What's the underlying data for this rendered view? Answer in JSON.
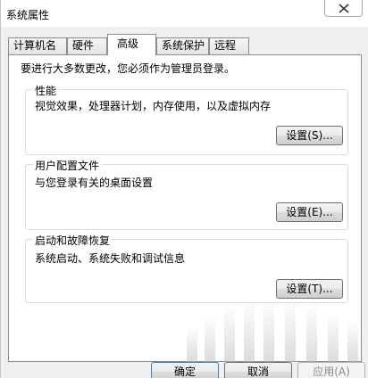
{
  "window": {
    "title": "系统属性"
  },
  "tabs": [
    {
      "label": "计算机名"
    },
    {
      "label": "硬件"
    },
    {
      "label": "高级",
      "active": true
    },
    {
      "label": "系统保护"
    },
    {
      "label": "远程"
    }
  ],
  "notice": "要进行大多数更改，您必须作为管理员登录。",
  "groups": {
    "performance": {
      "title": "性能",
      "description": "视觉效果，处理器计划，内存使用，以及虚拟内存",
      "button": "设置(S)..."
    },
    "profiles": {
      "title": "用户配置文件",
      "description": "与您登录有关的桌面设置",
      "button": "设置(E)..."
    },
    "startup": {
      "title": "启动和故障恢复",
      "description": "系统启动、系统失败和调试信息",
      "button": "设置(T)..."
    }
  },
  "buttons": {
    "ok": "确定",
    "cancel": "取消",
    "apply": "应用(A)"
  },
  "icons": {
    "close": "close-icon"
  }
}
